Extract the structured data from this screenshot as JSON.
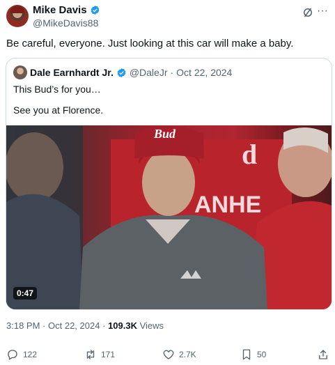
{
  "author": {
    "name": "Mike Davis",
    "handle": "@MikeDavis88"
  },
  "tweet": {
    "text": "Be careful, everyone. Just looking at this car will make a baby."
  },
  "quote": {
    "name": "Dale Earnhardt Jr.",
    "handle": "@DaleJr",
    "separator": "·",
    "date": "Oct 22, 2024",
    "line1": "This Bud’s for you…",
    "line2": "See you at Florence.",
    "video": {
      "duration": "0:47",
      "cap_text": "Bud",
      "banner_text": "ANHE",
      "banner_text2": "d"
    }
  },
  "meta": {
    "time": "3:18 PM",
    "separator": "·",
    "date": "Oct 22, 2024",
    "views_count": "109.3K",
    "views_label": "Views"
  },
  "actions": {
    "replies": "122",
    "reposts": "171",
    "likes": "2.7K",
    "bookmarks": "50"
  },
  "colors": {
    "accent": "#1d9bf0",
    "text": "#0f1419",
    "muted": "#536471",
    "border": "#cfd9de"
  }
}
